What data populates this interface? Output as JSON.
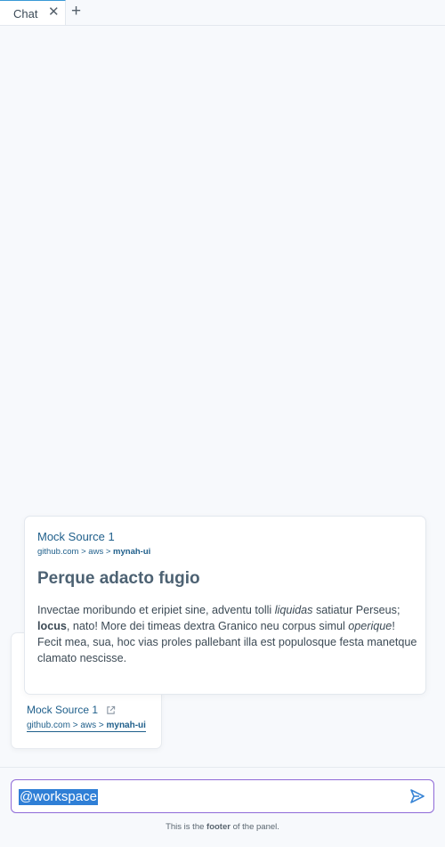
{
  "tabs": [
    {
      "label": "Chat",
      "close_icon": "close-icon"
    }
  ],
  "add_tab_icon": "plus-icon",
  "source_card": {
    "title": "Mock Source 1",
    "external_icon": "external-link-icon",
    "url_prefix": "github.com > aws > ",
    "url_tail": "mynah-ui"
  },
  "hover_card": {
    "title": "Mock Source 1",
    "url_prefix": "github.com > aws > ",
    "url_tail": "mynah-ui",
    "heading": "Perque adacto fugio",
    "body": {
      "s1": "Invectae moribundo et eripiet sine, adventu tolli ",
      "s1_em": "liquidas",
      "s1_end": " satiatur Perseus;",
      "s2_bold": "locus",
      "s2": ", nato! More dei timeas dextra Granico neu corpus simul ",
      "s2_em": "operique",
      "s2_end": "!",
      "s3": "Fecit mea, sua, hoc vias proles pallebant illa est populosque festa manetque",
      "s4": "clamato nescisse."
    }
  },
  "prompt": {
    "value": "@workspace",
    "send_icon": "send-icon"
  },
  "footer": {
    "pre": "This is the ",
    "bold": "footer",
    "post": " of the panel."
  },
  "colors": {
    "accent": "#3a99d6",
    "link": "#1f5f8b",
    "prompt_border": "#8f6ad8",
    "selection": "#2f7fd6",
    "background": "#f7f9fc"
  }
}
